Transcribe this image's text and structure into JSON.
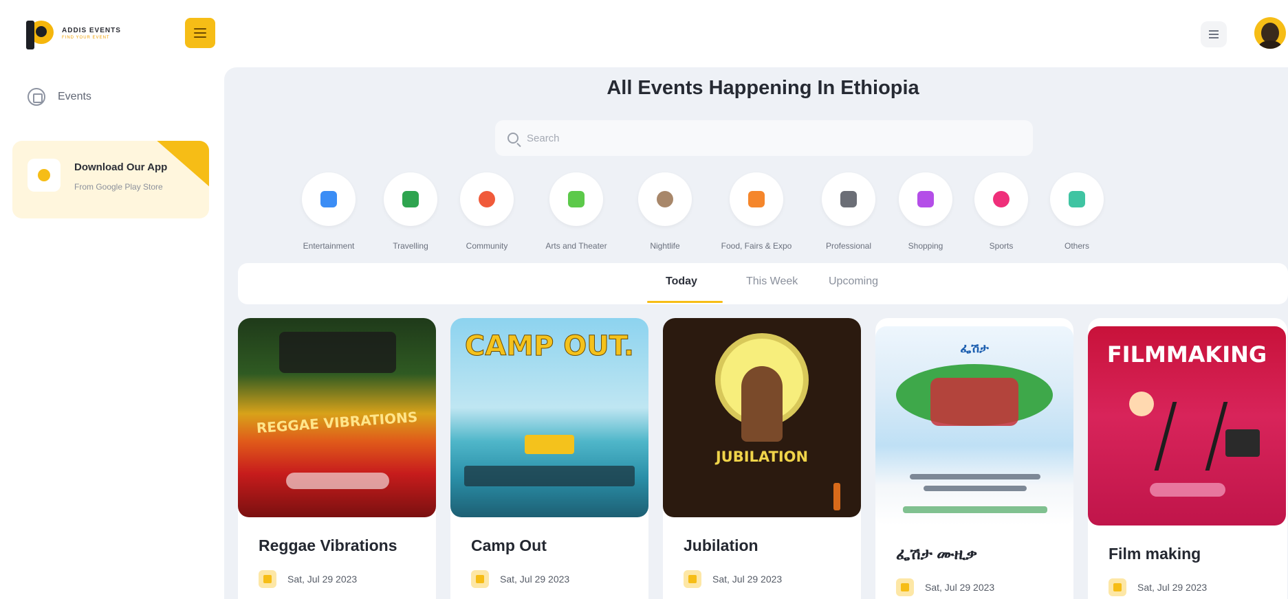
{
  "brand": {
    "line1": "ADDIS EVENTS",
    "line2": "FIND YOUR EVENT"
  },
  "sidebar": {
    "nav": [
      {
        "label": "Events",
        "icon": "compass-icon"
      }
    ],
    "download": {
      "title": "Download Our App",
      "subtitle": "From Google Play Store"
    }
  },
  "page": {
    "title": "All Events Happening In Ethiopia",
    "search_placeholder": "Search"
  },
  "categories": [
    {
      "label": "Entertainment",
      "color": "#3b8df5"
    },
    {
      "label": "Travelling",
      "color": "#2ea44f"
    },
    {
      "label": "Community",
      "color": "#f05a3a"
    },
    {
      "label": "Arts and Theater",
      "color": "#5cc94a"
    },
    {
      "label": "Nightlife",
      "color": "#a8876a"
    },
    {
      "label": "Food, Fairs & Expo",
      "color": "#f5862b"
    },
    {
      "label": "Professional",
      "color": "#6b6e76"
    },
    {
      "label": "Shopping",
      "color": "#b44ee8"
    },
    {
      "label": "Sports",
      "color": "#ef2f7a"
    },
    {
      "label": "Others",
      "color": "#3fc4a2"
    }
  ],
  "tabs": [
    {
      "label": "Today",
      "active": true
    },
    {
      "label": "This Week",
      "active": false
    },
    {
      "label": "Upcoming",
      "active": false
    }
  ],
  "events": [
    {
      "title": "Reggae Vibrations",
      "date": "Sat, Jul 29 2023",
      "poster_text": "REGGAE VIBRATIONS"
    },
    {
      "title": "Camp Out",
      "date": "Sat, Jul 29 2023",
      "poster_text": "CAMP OUT."
    },
    {
      "title": "Jubilation",
      "date": "Sat, Jul 29 2023",
      "poster_text": "JUBILATION"
    },
    {
      "title": "ፌሽታ ሙዚቃ",
      "date": "Sat, Jul 29 2023",
      "poster_text": "ፌሽታ"
    },
    {
      "title": "Film making",
      "date": "Sat, Jul 29 2023",
      "poster_text": "FILMMAKING"
    }
  ]
}
